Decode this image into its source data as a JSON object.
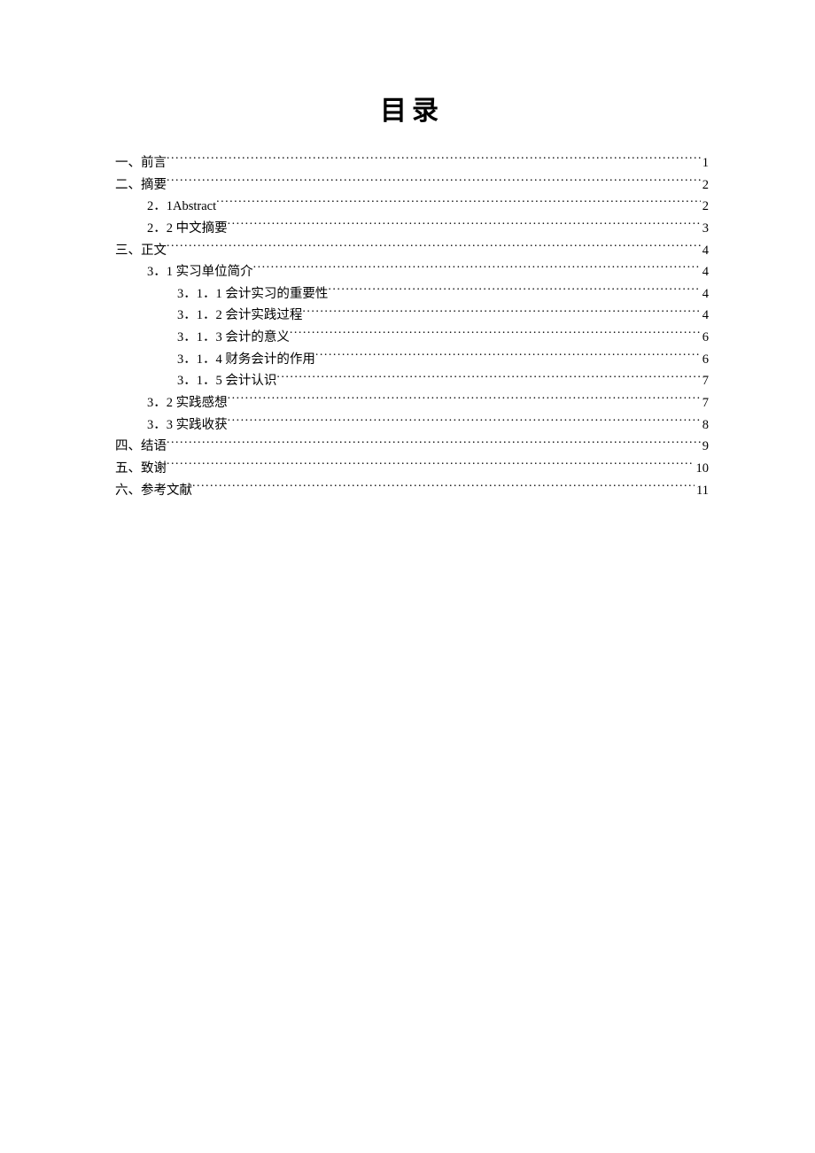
{
  "title": "目录",
  "entries": [
    {
      "indent": 0,
      "label": "一、前言",
      "page": "1"
    },
    {
      "indent": 0,
      "label": "二、摘要",
      "page": "2"
    },
    {
      "indent": 1,
      "label": "2．1Abstract",
      "page": "2"
    },
    {
      "indent": 1,
      "label": "2．2 中文摘要",
      "page": "3"
    },
    {
      "indent": 0,
      "label": "三、正文",
      "page": "4"
    },
    {
      "indent": 1,
      "label": "3．1 实习单位简介",
      "page": "4"
    },
    {
      "indent": 2,
      "label": "3．1．1 会计实习的重要性",
      "page": "4"
    },
    {
      "indent": 2,
      "label": "3．1．2  会计实践过程",
      "page": "4"
    },
    {
      "indent": 2,
      "label": "3．1．3 会计的意义",
      "page": "6"
    },
    {
      "indent": 2,
      "label": "3．1．4 财务会计的作用",
      "page": "6"
    },
    {
      "indent": 2,
      "label": "3．1．5 会计认识",
      "page": "7"
    },
    {
      "indent": 1,
      "label": "3．2 实践感想",
      "page": "7"
    },
    {
      "indent": 1,
      "label": "3．3 实践收获",
      "page": "8"
    },
    {
      "indent": 0,
      "label": "四、结语",
      "page": "9"
    },
    {
      "indent": 0,
      "label": "五、致谢",
      "page": "10"
    },
    {
      "indent": 0,
      "label": "六、参考文献",
      "page": "11"
    }
  ]
}
